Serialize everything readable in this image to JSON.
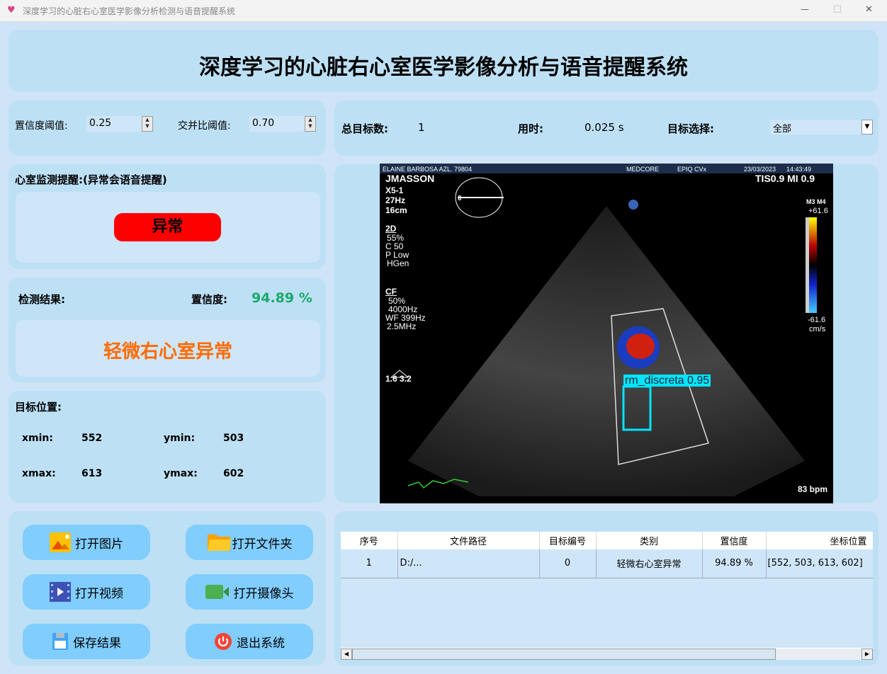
{
  "window": {
    "title": "深度学习的心脏右心室医学影像分析检测与语音提醒系统",
    "min": "—",
    "max": "□",
    "close": "✕"
  },
  "header": {
    "title": "深度学习的心脏右心室医学影像分析与语音提醒系统"
  },
  "thresholds": {
    "conf_label": "置信度阈值:",
    "conf_value": "0.25",
    "iou_label": "交并比阈值:",
    "iou_value": "0.70"
  },
  "stats": {
    "total_label": "总目标数:",
    "total_value": "1",
    "time_label": "用时:",
    "time_value": "0.025 s",
    "select_label": "目标选择:",
    "select_value": "全部"
  },
  "alert": {
    "label": "心室监测提醒:(异常会语音提醒)",
    "status": "异常",
    "status_color": "#ff0000"
  },
  "result": {
    "label": "检测结果:",
    "conf_label": "置信度:",
    "conf_value": "94.89 %",
    "class": "轻微右心室异常",
    "class_color": "#ff6a00"
  },
  "position": {
    "label": "目标位置:",
    "xmin_label": "xmin:",
    "xmin": "552",
    "ymin_label": "ymin:",
    "ymin": "503",
    "xmax_label": "xmax:",
    "xmax": "613",
    "ymax_label": "ymax:",
    "ymax": "602"
  },
  "image": {
    "patient": "ELAINE BARBOSA AZL.  79804",
    "vendor": "MEDCORE",
    "model": "EPIQ CVx",
    "date": "23/03/2023",
    "time": "14:43:49",
    "operator": "JMASSON",
    "tis": "TIS0.9  MI 0.9",
    "left_params": [
      "X5-1",
      "27Hz",
      "16cm"
    ],
    "mode2d": "2D",
    "params2d": [
      "55%",
      "C 50",
      "P Low",
      "HGen"
    ],
    "modecf": "CF",
    "paramscf": [
      "50%",
      "4000Hz",
      "WF 399Hz",
      "2.5MHz"
    ],
    "scale_top": "+61.6",
    "scale_bottom": "-61.6",
    "scale_unit": "cm/s",
    "scale_hdr": "M3  M4",
    "bottom_vals": "1.6  3.2",
    "bpm": "83 bpm",
    "detection_label": "rm_discreta  0.95",
    "angle": "0"
  },
  "buttons": [
    {
      "label": "打开图片",
      "icon": "image-icon"
    },
    {
      "label": "打开文件夹",
      "icon": "folder-icon"
    },
    {
      "label": "打开视频",
      "icon": "video-icon"
    },
    {
      "label": "打开摄像头",
      "icon": "camera-icon"
    },
    {
      "label": "保存结果",
      "icon": "save-icon"
    },
    {
      "label": "退出系统",
      "icon": "power-icon"
    }
  ],
  "table": {
    "headers": [
      "序号",
      "文件路径",
      "目标编号",
      "类别",
      "置信度",
      "坐标位置"
    ],
    "rows": [
      [
        "1",
        "D:/...",
        "0",
        "轻微右心室异常",
        "94.89 %",
        "[552, 503, 613, 602]"
      ]
    ]
  }
}
